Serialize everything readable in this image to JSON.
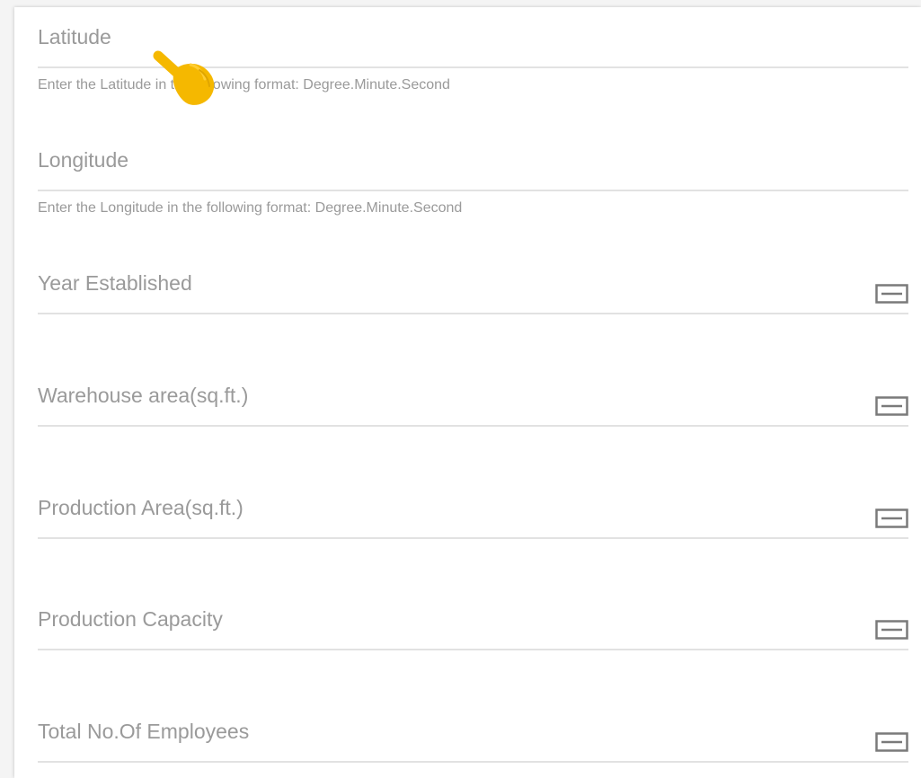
{
  "colors": {
    "label_text": "#9a9a9a",
    "underline": "#e2e2e2",
    "icon_stroke": "#7a7a7a",
    "pointer": "#f5b800"
  },
  "fields": {
    "latitude": {
      "label": "Latitude",
      "hint": "Enter the Latitude in the following format: Degree.Minute.Second"
    },
    "longitude": {
      "label": "Longitude",
      "hint": "Enter the Longitude in the following format: Degree.Minute.Second"
    },
    "year_established": {
      "label": "Year Established",
      "icon": "keyboard-icon"
    },
    "warehouse_area": {
      "label": "Warehouse area(sq.ft.)",
      "icon": "keyboard-icon"
    },
    "production_area": {
      "label": "Production Area(sq.ft.)",
      "icon": "keyboard-icon"
    },
    "production_capacity": {
      "label": "Production Capacity",
      "icon": "keyboard-icon"
    },
    "total_employees": {
      "label": "Total No.Of Employees",
      "icon": "keyboard-icon"
    }
  },
  "overlay": {
    "icon": "pointing-hand-icon"
  }
}
